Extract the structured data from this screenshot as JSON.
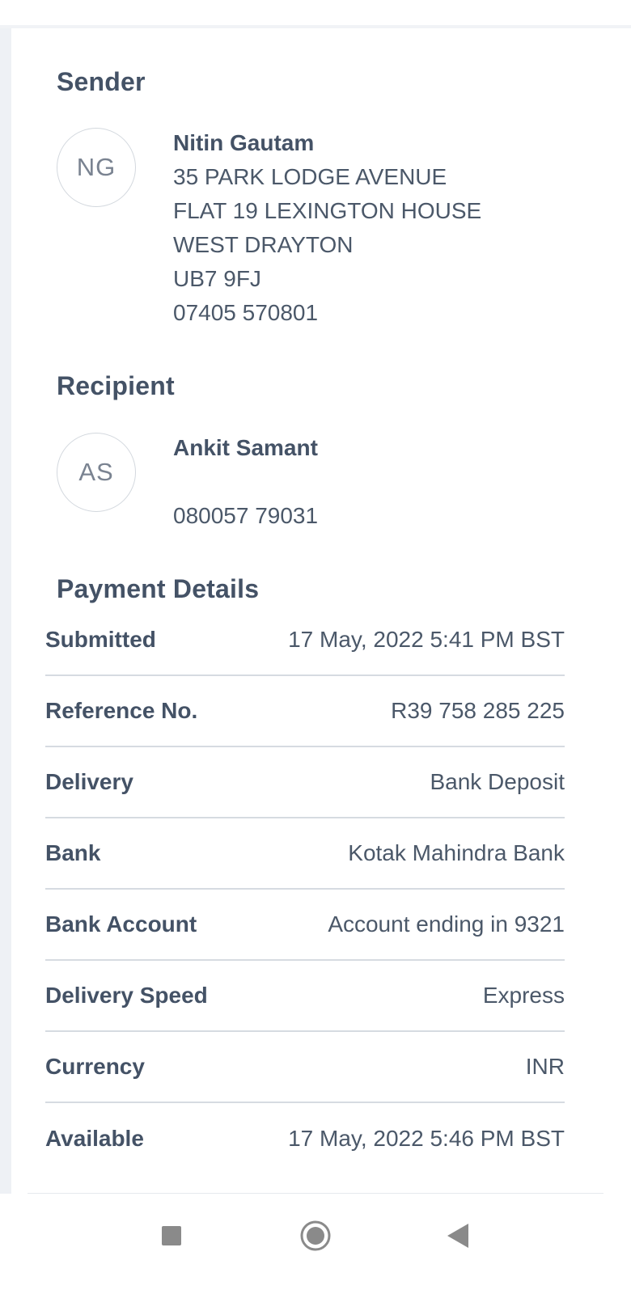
{
  "sender": {
    "title": "Sender",
    "initials": "NG",
    "name": "Nitin Gautam",
    "address_lines": [
      "35 PARK LODGE AVENUE",
      "FLAT 19 LEXINGTON HOUSE",
      "WEST DRAYTON",
      "UB7 9FJ"
    ],
    "phone": "07405 570801"
  },
  "recipient": {
    "title": "Recipient",
    "initials": "AS",
    "name": "Ankit Samant",
    "phone": "080057 79031"
  },
  "payment": {
    "title": "Payment Details",
    "rows": [
      {
        "label": "Submitted",
        "value": "17 May, 2022 5:41 PM BST"
      },
      {
        "label": "Reference No.",
        "value": "R39 758 285 225"
      },
      {
        "label": "Delivery",
        "value": "Bank Deposit"
      },
      {
        "label": "Bank",
        "value": "Kotak Mahindra Bank"
      },
      {
        "label": "Bank Account",
        "value": "Account ending in 9321"
      },
      {
        "label": "Delivery Speed",
        "value": "Express"
      },
      {
        "label": "Currency",
        "value": "INR"
      },
      {
        "label": "Available",
        "value": "17 May, 2022 5:46 PM BST"
      }
    ]
  },
  "navbar": {
    "icons": [
      "recents-square-icon",
      "home-circle-icon",
      "back-triangle-icon"
    ],
    "icon_color": "#8a8a8a"
  },
  "colors": {
    "text_primary": "#445266",
    "divider": "#d6dbe1",
    "rail": "#eef1f5"
  }
}
